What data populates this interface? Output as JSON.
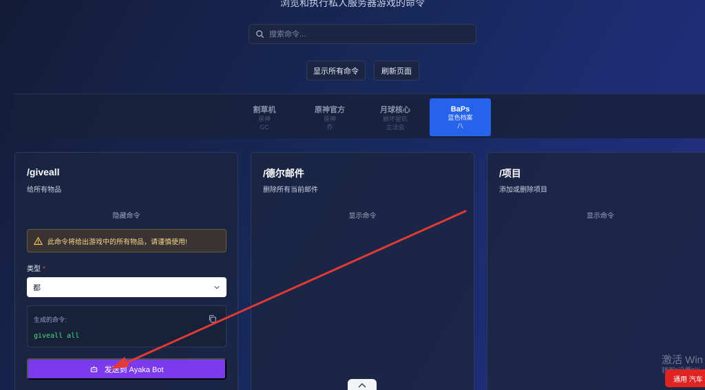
{
  "header": {
    "subtitle": "浏览和执行私人服务器游戏的命令"
  },
  "search": {
    "placeholder": "搜索命令..."
  },
  "actions": {
    "show_all": "显示所有命令",
    "refresh": "刷新页面"
  },
  "tabs": [
    {
      "name": "割草机",
      "line1": "原神",
      "line2": "GC"
    },
    {
      "name": "原神官方",
      "line1": "原神",
      "line2": "乔"
    },
    {
      "name": "月球核心",
      "line1": "崩坏星轨",
      "line2": "立法会"
    },
    {
      "name": "BaPs",
      "line1": "蓝色档案",
      "line2": "八",
      "active": true
    }
  ],
  "cards": [
    {
      "title": "/giveall",
      "desc": "给所有物品",
      "toggle": "隐藏命令",
      "warning": "此命令将给出游戏中的所有物品，请谨慎使用!",
      "type_label": "类型",
      "type_required": "*",
      "type_value": "都",
      "generated_label": "生成的命令:",
      "generated_cmd": "giveall all",
      "send_label": "发送到 Ayaka Bot"
    },
    {
      "title": "/德尔邮件",
      "desc": "删除所有当前邮件",
      "toggle": "显示命令"
    },
    {
      "title": "/项目",
      "desc": "添加或删除项目",
      "toggle": "显示命令"
    }
  ],
  "overlay": {
    "watermark_line1": "激活 Win",
    "watermark_line2": "转到\"设置\"以",
    "badge": "通用 汽车"
  },
  "colors": {
    "accent_blue": "#2563eb",
    "send_purple": "#7c3aed",
    "command_green": "#4ade80",
    "warning_text": "#f5d58a",
    "annotation_arrow": "#e53935"
  }
}
